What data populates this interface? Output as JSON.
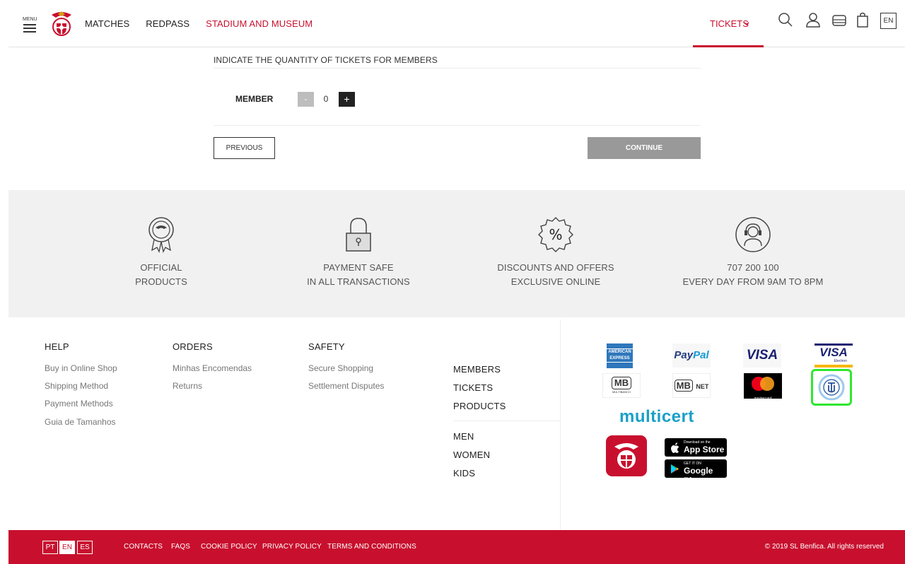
{
  "header": {
    "menu_label": "MENU",
    "nav": [
      "MATCHES",
      "REDPASS",
      "STADIUM AND MUSEUM"
    ],
    "tickets_label": "TICKETS",
    "lang": "EN"
  },
  "tickets": {
    "quantity_title": "INDICATE THE QUANTITY OF TICKETS FOR MEMBERS",
    "member_label": "MEMBER",
    "minus": "-",
    "quantity": "0",
    "plus": "+",
    "previous": "PREVIOUS",
    "continue": "CONTINUE"
  },
  "features": [
    {
      "line1": "OFFICIAL",
      "line2": "PRODUCTS"
    },
    {
      "line1": "PAYMENT SAFE",
      "line2": "IN ALL TRANSACTIONS"
    },
    {
      "line1": "DISCOUNTS AND OFFERS",
      "line2": "EXCLUSIVE ONLINE"
    },
    {
      "line1": "707 200 100",
      "line2": "EVERY DAY FROM 9AM TO 8PM"
    }
  ],
  "footer": {
    "help": {
      "title": "HELP",
      "links": [
        "Buy in Online Shop",
        "Shipping Method",
        "Payment Methods",
        "Guia de Tamanhos"
      ]
    },
    "orders": {
      "title": "ORDERS",
      "links": [
        "Minhas Encomendas",
        "Returns"
      ]
    },
    "safety": {
      "title": "SAFETY",
      "links": [
        "Secure Shopping",
        "Settlement Disputes"
      ]
    },
    "side_links_1": [
      "MEMBERS",
      "TICKETS",
      "PRODUCTS"
    ],
    "side_links_2": [
      "MEN",
      "WOMEN",
      "KIDS"
    ]
  },
  "payments": {
    "amex_line1": "AMERICAN",
    "amex_line2": "EXPRESS",
    "paypal_pay": "Pay",
    "paypal_pal": "Pal",
    "visa": "VISA",
    "visa_electron": "VISA",
    "visa_electron_sub": "Electron",
    "mb": "MB",
    "mb_sub": "MULTIBANCO",
    "mbnet_mb": "MB",
    "mbnet_net": "NET",
    "mastercard_sub": "mastercard",
    "multicert": "multicert",
    "appstore_top": "Download on the",
    "appstore_main": "App Store",
    "googleplay_top": "GET IT ON",
    "googleplay_main": "Google Play"
  },
  "bottom": {
    "langs": [
      "PT",
      "EN",
      "ES"
    ],
    "active_lang": "EN",
    "links": [
      "CONTACTS",
      "FAQS",
      "COOKIE POLICY",
      "PRIVACY POLICY",
      "TERMS AND CONDITIONS"
    ],
    "copyright": "© 2019 SL Benfica. All rights reserved"
  },
  "colors": {
    "brand_red": "#c8102e",
    "highlight_green": "#2ee82e"
  }
}
